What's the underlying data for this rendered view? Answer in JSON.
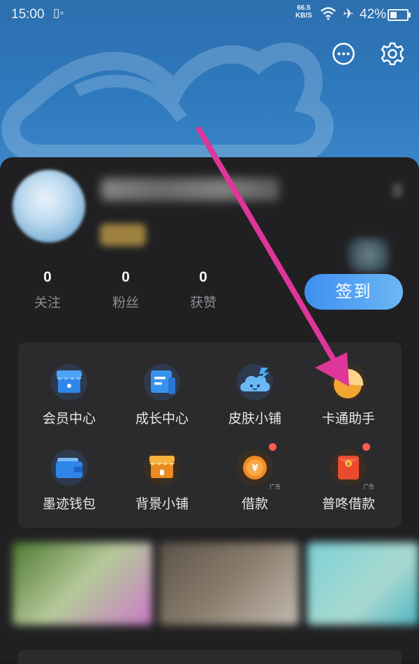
{
  "status_bar": {
    "time": "15:00",
    "network_speed_value": "66.5",
    "network_speed_unit": "KB/S",
    "battery": "42%"
  },
  "stats": [
    {
      "count": "0",
      "label": "关注"
    },
    {
      "count": "0",
      "label": "粉丝"
    },
    {
      "count": "0",
      "label": "获赞"
    }
  ],
  "signin_label": "签到",
  "features": [
    {
      "label": "会员中心",
      "icon": "vip-store-icon"
    },
    {
      "label": "成长中心",
      "icon": "growth-card-icon"
    },
    {
      "label": "皮肤小铺",
      "icon": "skin-cloud-icon"
    },
    {
      "label": "卡通助手",
      "icon": "cartoon-assistant-icon"
    },
    {
      "label": "墨迹钱包",
      "icon": "wallet-icon"
    },
    {
      "label": "背景小铺",
      "icon": "background-store-icon"
    },
    {
      "label": "借款",
      "icon": "loan-coin-icon",
      "badge": "广告"
    },
    {
      "label": "普咚借款",
      "icon": "red-packet-icon",
      "badge": "广告"
    }
  ],
  "colors": {
    "banner": "#2e79bd",
    "card": "#202022",
    "panel": "#2b2b2e",
    "signin_start": "#3e8ff0",
    "signin_end": "#6cb7f5",
    "annotation_arrow": "#e0369a"
  }
}
